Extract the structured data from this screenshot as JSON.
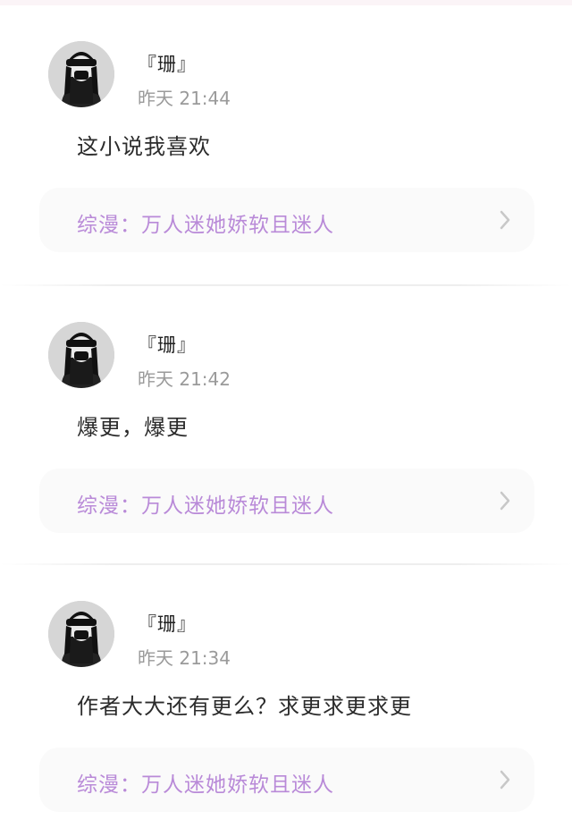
{
  "comments": [
    {
      "username": "『珊』",
      "time": "昨天 21:44",
      "text": "这小说我喜欢",
      "book": "综漫：万人迷她娇软且迷人",
      "avatar_icon": "user-avatar-icon"
    },
    {
      "username": "『珊』",
      "time": "昨天 21:42",
      "text": "爆更，爆更",
      "book": "综漫：万人迷她娇软且迷人",
      "avatar_icon": "user-avatar-icon"
    },
    {
      "username": "『珊』",
      "time": "昨天 21:34",
      "text": "作者大大还有更么？求更求更求更",
      "book": "综漫：万人迷她娇软且迷人",
      "avatar_icon": "user-avatar-icon"
    }
  ],
  "colors": {
    "book_title": "#b98ad8",
    "card_bg": "#fafafa",
    "top_strip": "#fbf4f7",
    "time": "#9a9a9a"
  }
}
